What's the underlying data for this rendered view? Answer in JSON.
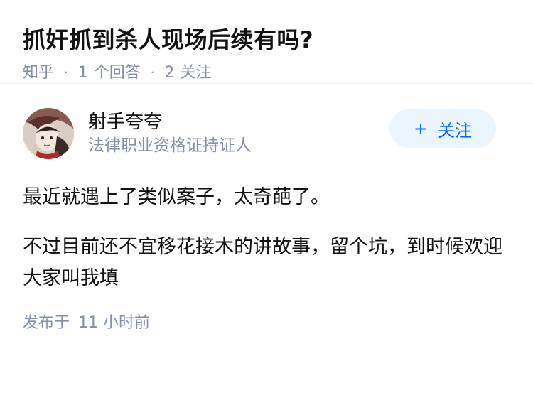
{
  "question": {
    "title": "抓奸抓到杀人现场后续有吗?",
    "meta": {
      "site": "知乎",
      "answer_count": "1",
      "answer_label": "个回答",
      "follower_count": "2",
      "follower_label": "关注"
    }
  },
  "answer": {
    "author": {
      "name": "射手夸夸",
      "description": "法律职业资格证持证人",
      "avatar": "avatar-illustration"
    },
    "follow_button": {
      "icon": "+",
      "label": "关注",
      "bg_color": "#ebf5fd",
      "text_color": "#0066ff"
    },
    "paragraphs": [
      "最近就遇上了类似案子，太奇葩了。",
      "不过目前还不宜移花接木的讲故事，留个坑，到时候欢迎大家叫我填"
    ],
    "published_label": "发布于",
    "published_time": "11 小时前"
  },
  "colors": {
    "text_primary": "#121212",
    "text_secondary": "#8590a6",
    "accent": "#0066ff"
  }
}
